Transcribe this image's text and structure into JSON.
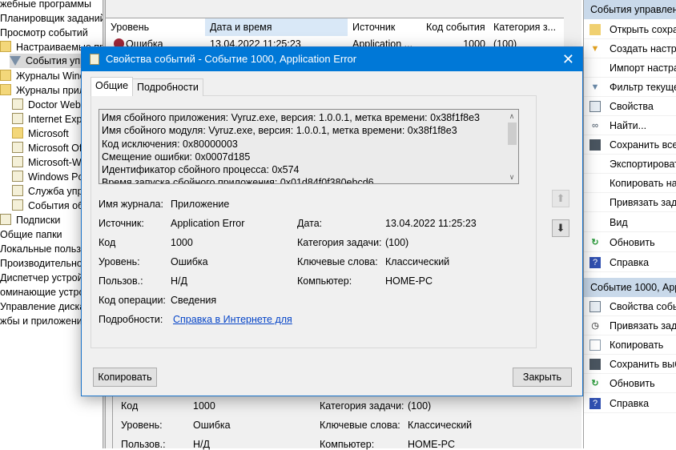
{
  "tree": {
    "items": [
      "жебные программы",
      "Планировщик заданий",
      "Просмотр событий",
      "Настраиваемые пр",
      "События упр",
      "Журналы Wind",
      "Журналы прил",
      "Doctor Web",
      "Internet Expl",
      "Microsoft",
      "Microsoft Of",
      "Microsoft-W",
      "Windows Po",
      "Служба упр",
      "События об",
      "Подписки",
      "Общие папки",
      "Локальные пользо",
      "Производительнос",
      "Диспетчер устройс",
      "оминающие устро",
      "Управление дискам",
      "жбы и приложени"
    ]
  },
  "grid": {
    "headers": [
      "Уровень",
      "Дата и время",
      "Источник",
      "Код события",
      "Категория з..."
    ],
    "row": [
      "Ошибка",
      "13.04.2022 11:25:23",
      "Application ...",
      "1000",
      "(100)"
    ]
  },
  "lower": {
    "rows": [
      [
        "Код",
        "1000",
        "Категория задачи:",
        "(100)"
      ],
      [
        "Уровень:",
        "Ошибка",
        "Ключевые слова:",
        "Классический"
      ],
      [
        "Пользов.:",
        "Н/Д",
        "Компьютер:",
        "HOME-PC"
      ]
    ]
  },
  "actions": {
    "header1": "События управлени",
    "items1": [
      "Открыть сохран",
      "Создать настра",
      "Импорт настра",
      "Фильтр текуще",
      "Свойства",
      "Найти...",
      "Сохранить все",
      "Экспортироват",
      "Копировать нас",
      "Привязать зада",
      "Вид",
      "Обновить",
      "Справка"
    ],
    "header2": "Событие 1000, Appl",
    "items2": [
      "Свойства событ",
      "Привязать зада",
      "Копировать",
      "Сохранить выб",
      "Обновить",
      "Справка"
    ]
  },
  "dialog": {
    "title": "Свойства событий - Событие 1000, Application Error",
    "tabs": [
      "Общие",
      "Подробности"
    ],
    "description": [
      "Имя сбойного приложения: Vyruz.exe, версия: 1.0.0.1, метка времени: 0x38f1f8e3",
      "Имя сбойного модуля: Vyruz.exe, версия: 1.0.0.1, метка времени: 0x38f1f8e3",
      "Код исключения: 0x80000003",
      "Смещение ошибки: 0x0007d185",
      "Идентификатор сбойного процесса: 0x574",
      "Время запуска сбойного приложения: 0x01d84f0f380ebcd6"
    ],
    "fields": {
      "log_label": "Имя журнала:",
      "log": "Приложение",
      "source_label": "Источник:",
      "source": "Application Error",
      "date_label": "Дата:",
      "date": "13.04.2022 11:25:23",
      "code_label": "Код",
      "code": "1000",
      "category_label": "Категория задачи:",
      "category": "(100)",
      "level_label": "Уровень:",
      "level": "Ошибка",
      "keywords_label": "Ключевые слова:",
      "keywords": "Классический",
      "user_label": "Пользов.:",
      "user": "Н/Д",
      "computer_label": "Компьютер:",
      "computer": "HOME-PC",
      "opcode_label": "Код операции:",
      "opcode": "Сведения",
      "details_label": "Подробности:",
      "details_link": "Справка в Интернете для"
    },
    "copy_button": "Копировать",
    "close_button": "Закрыть"
  }
}
